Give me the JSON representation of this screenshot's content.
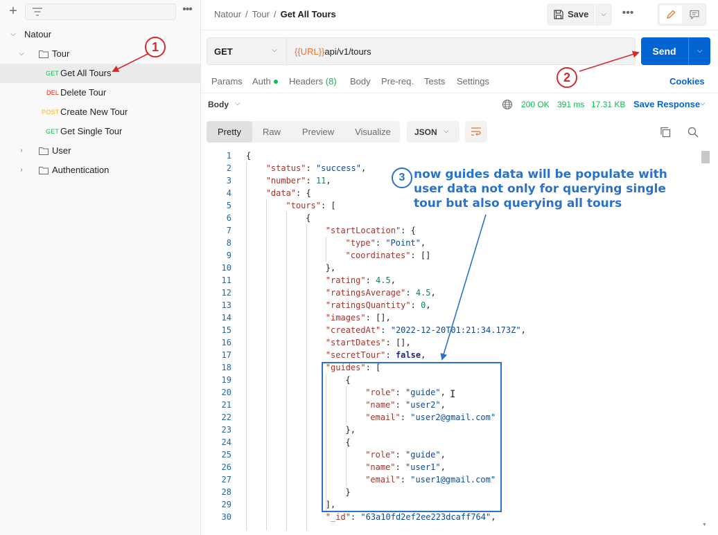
{
  "sidebar": {
    "collection": "Natour",
    "folders": {
      "tour": "Tour",
      "user": "User",
      "auth": "Authentication"
    },
    "requests": [
      {
        "method": "GET",
        "label": "Get All Tours"
      },
      {
        "method": "DEL",
        "label": "Delete Tour"
      },
      {
        "method": "POST",
        "label": "Create New Tour"
      },
      {
        "method": "GET",
        "label": "Get Single Tour"
      }
    ]
  },
  "header": {
    "breadcrumb": [
      "Natour",
      "Tour",
      "Get All Tours"
    ],
    "save_label": "Save"
  },
  "request": {
    "method": "GET",
    "url_var": "{{URL}}",
    "url_path": "api/v1/tours",
    "send_label": "Send",
    "tabs": {
      "params": "Params",
      "auth": "Auth",
      "headers": "Headers",
      "headers_count": "(8)",
      "body": "Body",
      "prereq": "Pre-req.",
      "tests": "Tests",
      "settings": "Settings"
    },
    "cookies": "Cookies"
  },
  "response": {
    "body_label": "Body",
    "status": "200 OK",
    "time": "391 ms",
    "size": "17.31 KB",
    "save_response": "Save Response",
    "views": [
      "Pretty",
      "Raw",
      "Preview",
      "Visualize"
    ],
    "format": "JSON"
  },
  "code_lines": [
    "{",
    "\"status\": \"success\",",
    "\"number\": 11,",
    "\"data\": {",
    "\"tours\": [",
    "{",
    "\"startLocation\": {",
    "\"type\": \"Point\",",
    "\"coordinates\": []",
    "},",
    "\"rating\": 4.5,",
    "\"ratingsAverage\": 4.5,",
    "\"ratingsQuantity\": 0,",
    "\"images\": [],",
    "\"createdAt\": \"2022-12-20T01:21:34.173Z\",",
    "\"startDates\": [],",
    "\"secretTour\": false,",
    "\"guides\": [",
    "{",
    "\"role\": \"guide\",",
    "\"name\": \"user2\",",
    "\"email\": \"user2@gmail.com\"",
    "},",
    "{",
    "\"role\": \"guide\",",
    "\"name\": \"user1\",",
    "\"email\": \"user1@gmail.com\"",
    "}",
    "],",
    "\"_id\": \"63a10fd2ef2ee223dcaff764\","
  ],
  "annotations": {
    "n1": "1",
    "n2": "2",
    "n3": "3",
    "note": "now guides data will be populate with user data not only for querying single tour but also querying all tours"
  },
  "colors": {
    "accent": "#0265d2",
    "get": "#0cbb52",
    "delete": "#eb2013",
    "post": "#ffb400",
    "annotation_red": "#d42a2a",
    "annotation_blue": "#2a72c8"
  }
}
